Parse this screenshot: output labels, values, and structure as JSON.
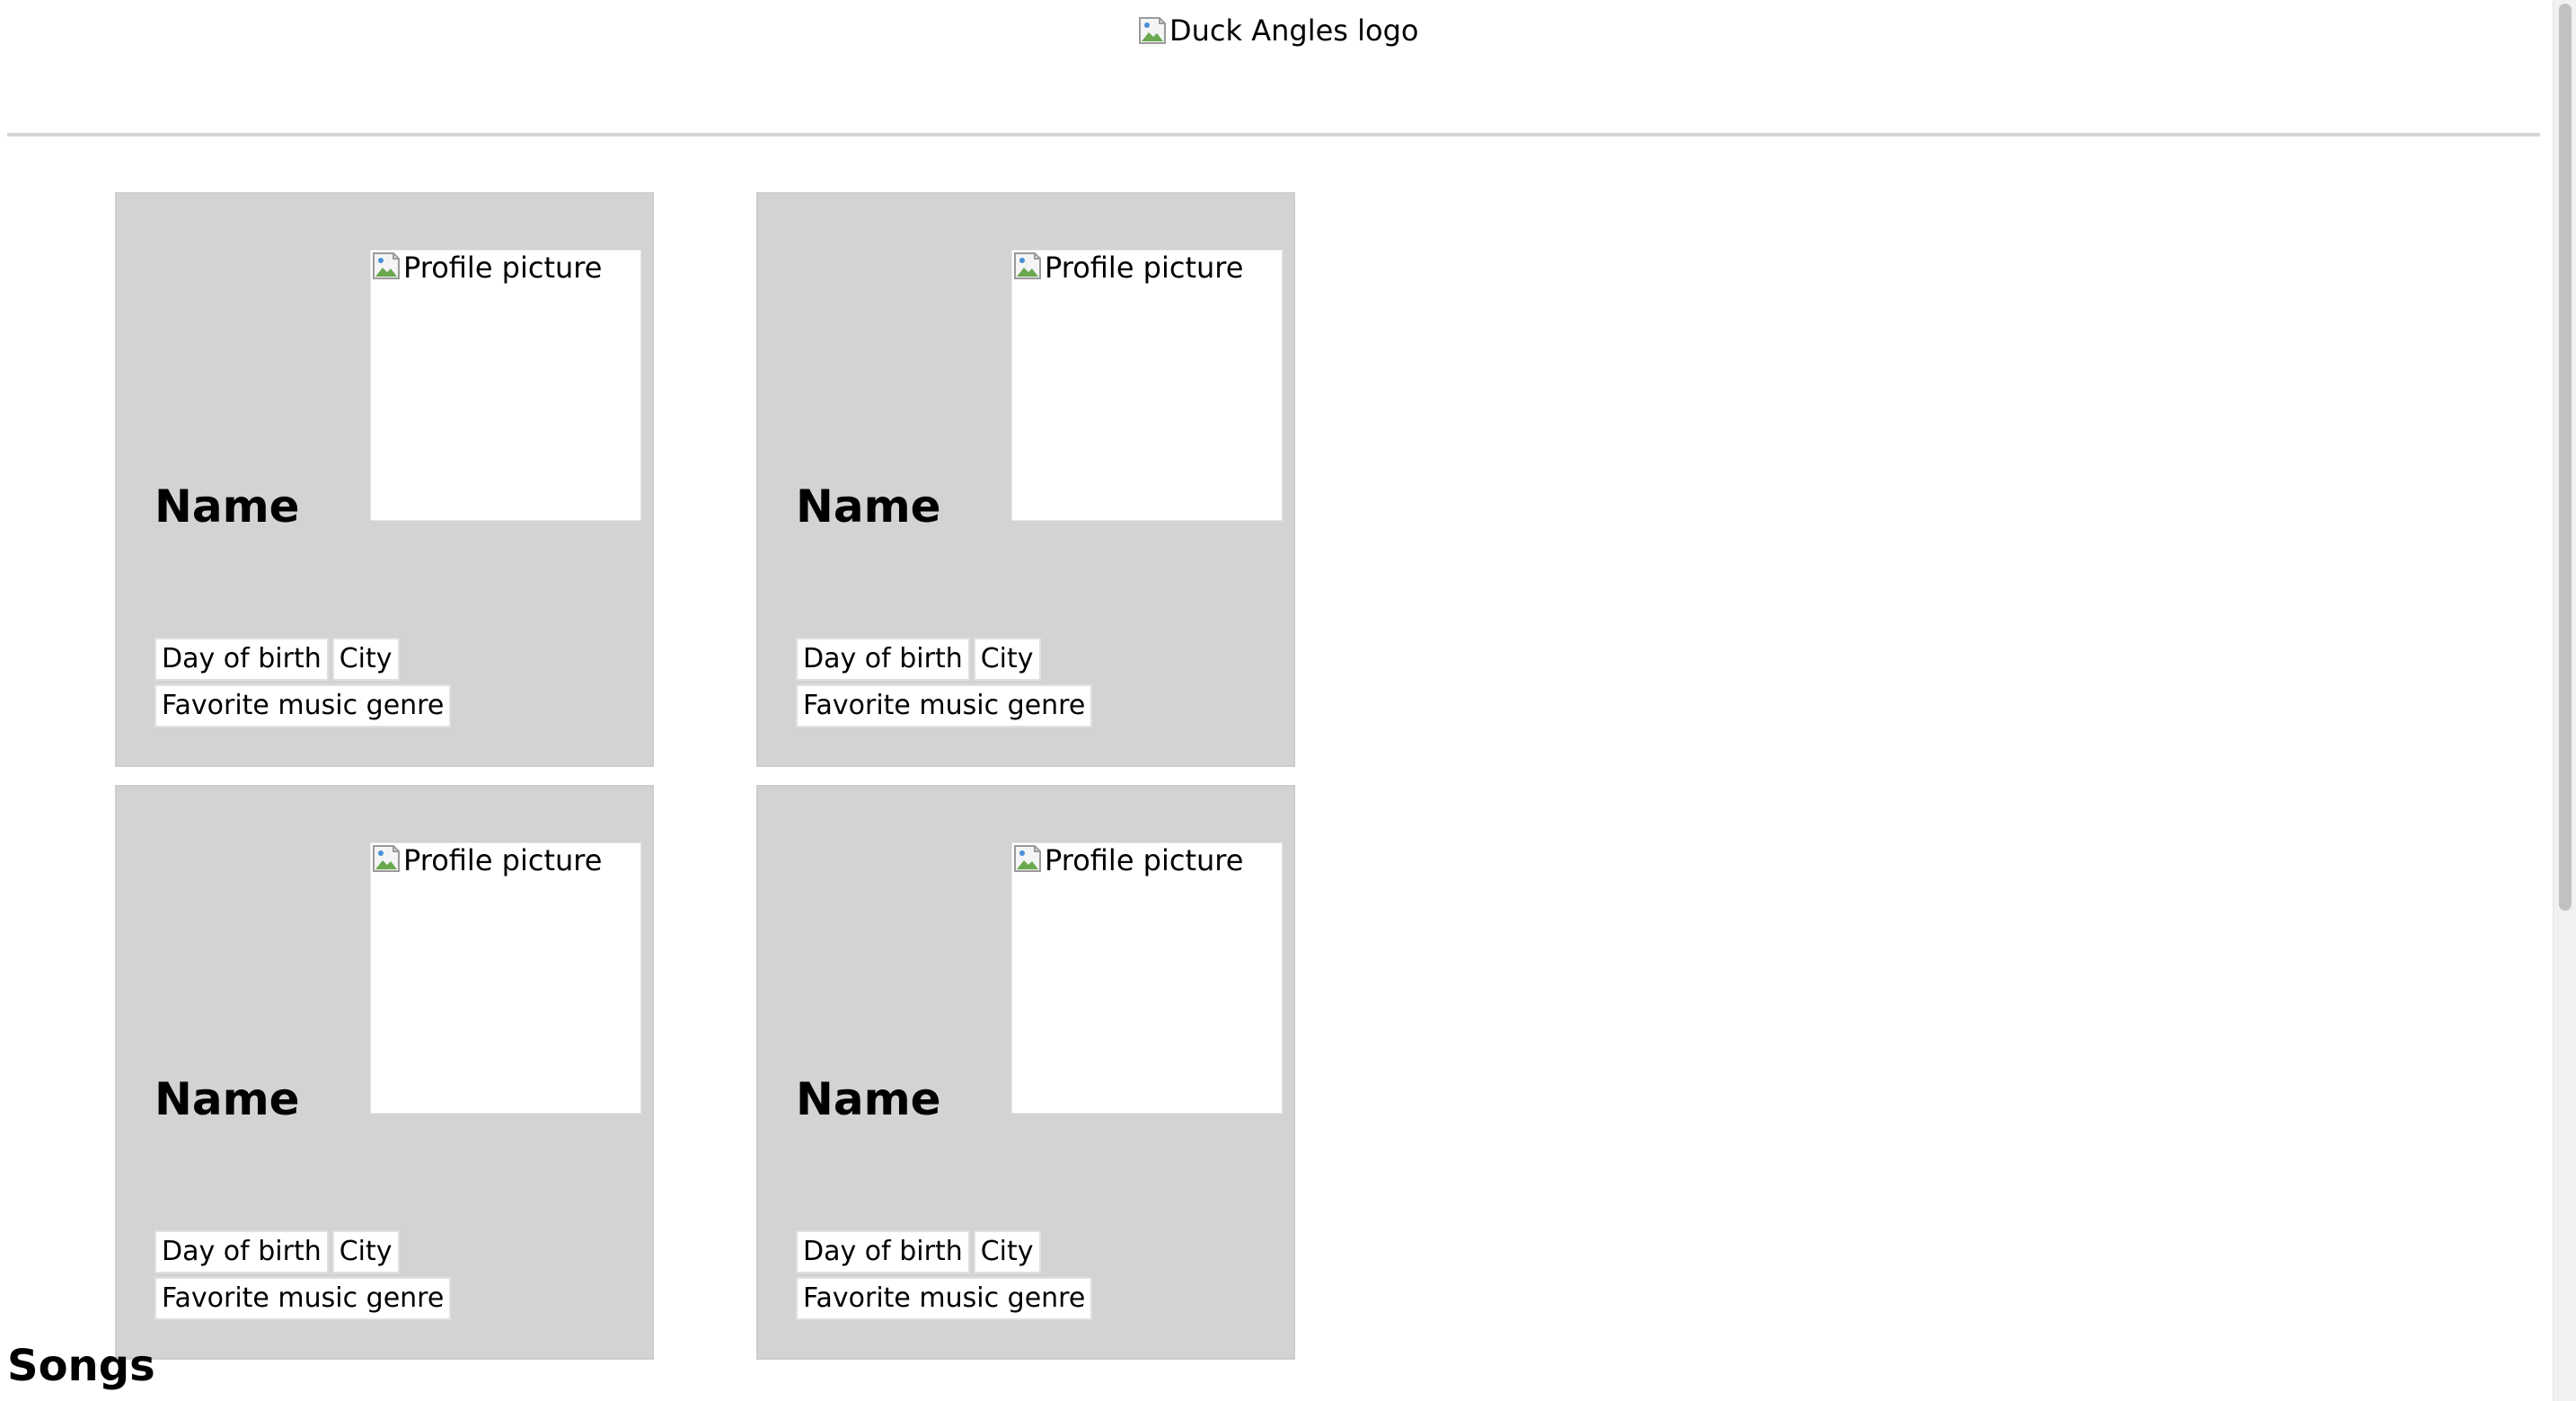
{
  "header": {
    "logo_alt": "Duck Angles logo",
    "logo_icon": "broken-image-icon"
  },
  "members": [
    {
      "name": "Name",
      "photo_alt": "Profile picture",
      "day_of_birth": "Day of birth",
      "city": "City",
      "favorite_genre": "Favorite music genre"
    },
    {
      "name": "Name",
      "photo_alt": "Profile picture",
      "day_of_birth": "Day of birth",
      "city": "City",
      "favorite_genre": "Favorite music genre"
    },
    {
      "name": "Name",
      "photo_alt": "Profile picture",
      "day_of_birth": "Day of birth",
      "city": "City",
      "favorite_genre": "Favorite music genre"
    },
    {
      "name": "Name",
      "photo_alt": "Profile picture",
      "day_of_birth": "Day of birth",
      "city": "City",
      "favorite_genre": "Favorite music genre"
    }
  ],
  "songs": {
    "heading": "Songs"
  },
  "colors": {
    "card_background": "#d3d3d3",
    "chip_background": "#ffffff",
    "rule": "#d6d6d6"
  }
}
